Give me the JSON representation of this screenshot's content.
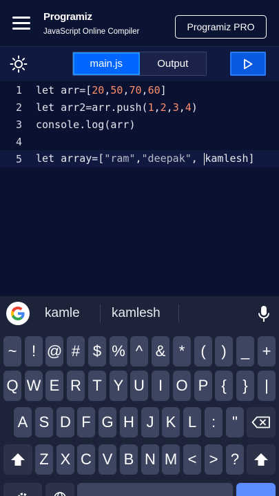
{
  "header": {
    "brand": "Programiz",
    "subtitle": "JavaScript Online Compiler",
    "pro_button": "Programiz PRO"
  },
  "toolbar": {
    "theme_icon": "sun-icon",
    "tabs": [
      {
        "label": "main.js",
        "active": true
      },
      {
        "label": "Output",
        "active": false
      }
    ],
    "run_icon": "play-icon"
  },
  "editor": {
    "lines": [
      {
        "num": "1",
        "text": "let arr=[20,50,70,60]"
      },
      {
        "num": "2",
        "text": "let arr2=arr.push(1,2,3,4)"
      },
      {
        "num": "3",
        "text": "console.log(arr)"
      },
      {
        "num": "4",
        "text": ""
      },
      {
        "num": "5",
        "text": "let array=[\"ram\",\"deepak\", kamlesh]"
      }
    ],
    "line5_before_caret": "let array=[\"ram\",\"deepak\", ",
    "line5_after_caret": "kamlesh]"
  },
  "keyboard": {
    "suggestions": [
      "kamle",
      "kamlesh"
    ],
    "row_symbols": [
      "~",
      "!",
      "@",
      "#",
      "$",
      "%",
      "^",
      "&",
      "*",
      "(",
      ")",
      "_",
      "+"
    ],
    "row_q": [
      "Q",
      "W",
      "E",
      "R",
      "T",
      "Y",
      "U",
      "I",
      "O",
      "P",
      "{",
      "}",
      "|"
    ],
    "row_a": [
      "A",
      "S",
      "D",
      "F",
      "G",
      "H",
      "J",
      "K",
      "L",
      ":",
      "\""
    ],
    "row_z": [
      "Z",
      "X",
      "C",
      "V",
      "B",
      "N",
      "M",
      "<",
      ">",
      "?"
    ],
    "colors": {
      "key": "#3d4561",
      "fn_key": "#2c3349",
      "accent": "#5d8dff"
    }
  },
  "colors": {
    "background": "#0b1234",
    "tab_active": "#0066ff",
    "number": "#ff8f6b"
  }
}
